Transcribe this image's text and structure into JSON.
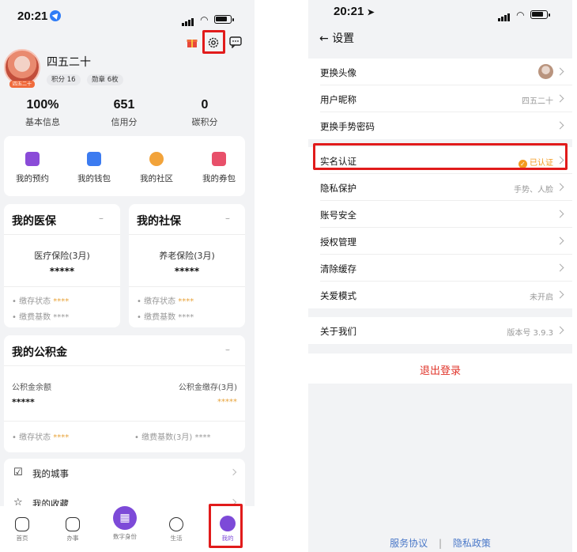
{
  "left": {
    "status": {
      "time": "20:21"
    },
    "user": {
      "name": "四五二十",
      "points_badge": "积分 16",
      "medal_badge": "勋章 6枚",
      "avatar_tag": "四五二十"
    },
    "stats": [
      {
        "value": "100%",
        "label": "基本信息"
      },
      {
        "value": "651",
        "label": "信用分"
      },
      {
        "value": "0",
        "label": "碳积分"
      }
    ],
    "quick": [
      {
        "label": "我的预约",
        "icon": "calendar-icon",
        "color": "#8a4bd8"
      },
      {
        "label": "我的钱包",
        "icon": "wallet-icon",
        "color": "#3c7bf0"
      },
      {
        "label": "我的社区",
        "icon": "community-icon",
        "color": "#f2a33a"
      },
      {
        "label": "我的券包",
        "icon": "coupon-icon",
        "color": "#e8506a"
      }
    ],
    "medical": {
      "title": "我的医保",
      "item": "医疗保险(3月)",
      "masked": "*****",
      "status_label": "缴存状态",
      "status_val": "****",
      "base_label": "缴费基数",
      "base_val": "****"
    },
    "social": {
      "title": "我的社保",
      "item": "养老保险(3月)",
      "masked": "*****",
      "status_label": "缴存状态",
      "status_val": "****",
      "base_label": "缴费基数",
      "base_val": "****"
    },
    "fund": {
      "title": "我的公积金",
      "balance_label": "公积金余额",
      "balance_val": "*****",
      "deposit_label": "公积金缴存(3月)",
      "deposit_val": "*****",
      "status_label": "缴存状态",
      "status_val": "****",
      "base_label": "缴费基数(3月)",
      "base_val": "****"
    },
    "list": [
      {
        "label": "我的城事",
        "icon": "edit-icon"
      },
      {
        "label": "我的收藏",
        "icon": "star-icon"
      }
    ],
    "tabs": [
      {
        "label": "首页",
        "icon": "home-icon"
      },
      {
        "label": "办事",
        "icon": "service-icon"
      },
      {
        "label": "数字身份",
        "icon": "qr-icon"
      },
      {
        "label": "生活",
        "icon": "life-icon"
      },
      {
        "label": "我的",
        "icon": "profile-icon"
      }
    ]
  },
  "right": {
    "status": {
      "time": "20:21"
    },
    "header": {
      "title": "设置"
    },
    "group1": [
      {
        "label": "更换头像",
        "value": ""
      },
      {
        "label": "用户昵称",
        "value": "四五二十"
      },
      {
        "label": "更换手势密码",
        "value": ""
      }
    ],
    "group2": [
      {
        "label": "实名认证",
        "value": "已认证"
      },
      {
        "label": "隐私保护",
        "value": "手势、人脸"
      },
      {
        "label": "账号安全",
        "value": ""
      },
      {
        "label": "授权管理",
        "value": ""
      },
      {
        "label": "清除缓存",
        "value": ""
      },
      {
        "label": "关爱模式",
        "value": "未开启"
      }
    ],
    "group3": [
      {
        "label": "关于我们",
        "value": "版本号 3.9.3"
      }
    ],
    "logout": "退出登录",
    "footer": {
      "terms": "服务协议",
      "sep": "|",
      "privacy": "隐私政策"
    },
    "colors": {
      "accent_red": "#e11b1b",
      "logout_red": "#e0352b",
      "link_blue": "#4a78c8",
      "verified_orange": "#f39a1e"
    }
  }
}
